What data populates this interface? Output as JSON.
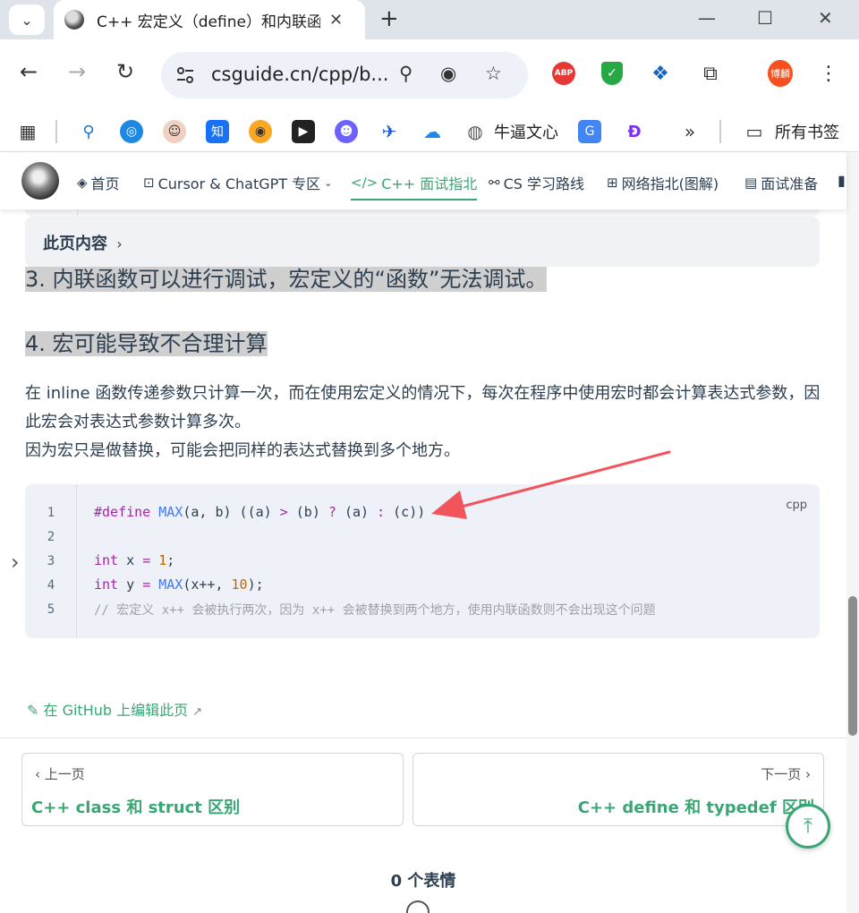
{
  "browser": {
    "tab_title": "C++ 宏定义（define）和内联函数（inline）的区别",
    "url": "csguide.cn/cpp/b...",
    "bookmarks": {
      "wenxin": "牛逼文心",
      "all_bookmarks": "所有书签",
      "zhi": "知"
    },
    "profile": "博麟",
    "abp": "ABP"
  },
  "sitenav": {
    "items": [
      {
        "label": "首页"
      },
      {
        "label": "Cursor & ChatGPT 专区"
      },
      {
        "label": "C++ 面试指北"
      },
      {
        "label": "CS 学习路线"
      },
      {
        "label": "网络指北(图解)"
      },
      {
        "label": "面试准备"
      }
    ]
  },
  "content": {
    "on_this_page": "此页内容",
    "h3_point3": "3. 内联函数可以进行调试，宏定义的“函数”无法调试。",
    "h3_point4": "4. 宏可能导致不合理计算",
    "para1": "在 inline 函数传递参数只计算一次，而在使用宏定义的情况下，每次在程序中使用宏时都会计算表达式参数，因此宏会对表达式参数计算多次。",
    "para2": "因为宏只是做替换，可能会把同样的表达式替换到多个地方。",
    "code": {
      "lang": "cpp",
      "line_numbers": [
        "1",
        "2",
        "3",
        "4",
        "5"
      ],
      "line1": {
        "kw": "#define",
        "fn": "MAX",
        "a": "(a, b) ((a) ",
        "gt": ">",
        "b": " (b) ",
        "q": "?",
        "c": " (a) ",
        "colon": ":",
        "d": " (c))"
      },
      "line3": {
        "kw": "int",
        "a": " x ",
        "eq": "=",
        "sp": " ",
        "num": "1",
        "end": ";"
      },
      "line4": {
        "kw": "int",
        "a": " y ",
        "eq": "=",
        "sp": " ",
        "fn": "MAX",
        "b": "(x++, ",
        "num": "10",
        "end": ");"
      },
      "line5": "// 宏定义 x++ 会被执行两次，因为 x++ 会被替换到两个地方，使用内联函数则不会出现这个问题"
    },
    "edit_link": "在 GitHub 上编辑此页",
    "prev": {
      "label": "上一页",
      "title": "C++ class 和 struct 区别"
    },
    "next": {
      "label": "下一页",
      "title": "C++ define 和 typedef 区别"
    },
    "reactions": "0 个表情"
  },
  "colors": {
    "accent": "#3aa675",
    "arrow": "#f2545b"
  }
}
